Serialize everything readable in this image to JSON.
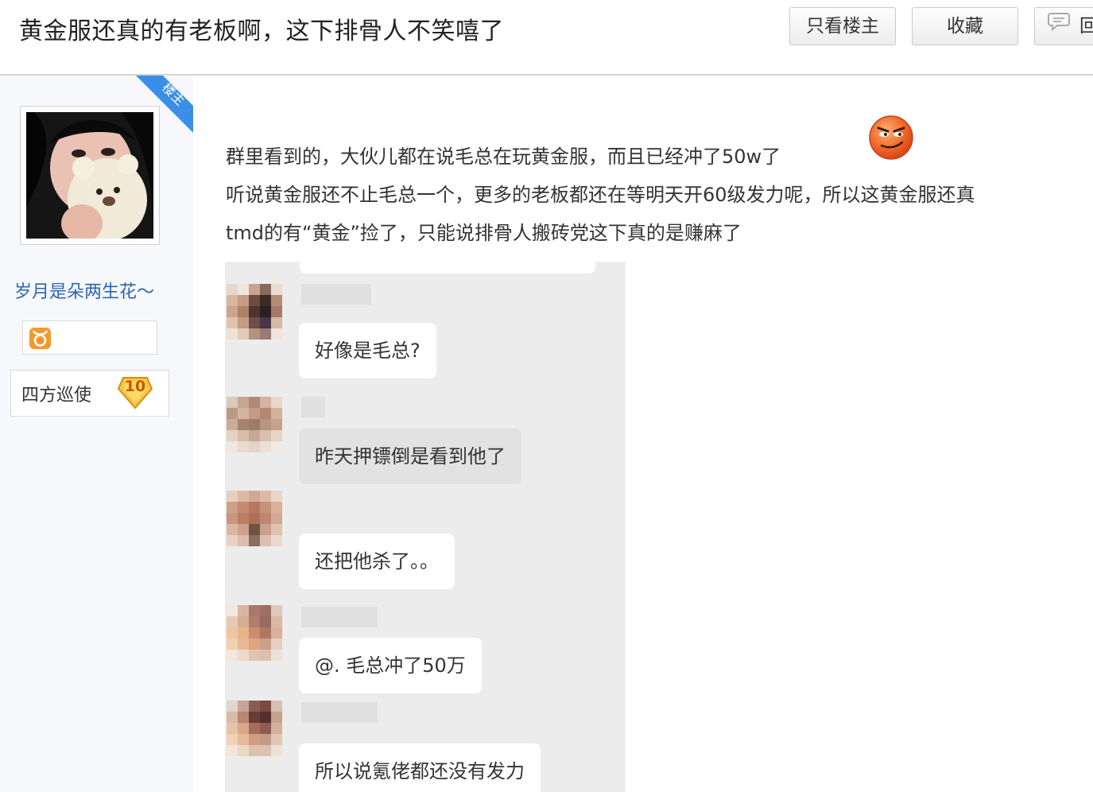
{
  "header": {
    "title": "黄金服还真的有老板啊，这下排骨人不笑嘻了",
    "btn_only_op": "只看楼主",
    "btn_favorite": "收藏",
    "btn_reply": "回复"
  },
  "author": {
    "badge": "楼主",
    "username": "岁月是朵两生花～",
    "level_title": "四方巡使",
    "level": "10",
    "icons": [
      "taurus-icon"
    ]
  },
  "post": {
    "lines": [
      "群里看到的，大伙儿都在说毛总在玩黄金服，而且已经冲了50w了",
      "听说黄金服还不止毛总一个，更多的老板都还在等明天开60级发力呢，所以这黄金服还真",
      "tmd的有“黄金”捡了，只能说排骨人搬砖党这下真的是赚麻了"
    ]
  },
  "chat": {
    "messages": [
      {
        "text": "好像是毛总?",
        "style": "white"
      },
      {
        "text": "昨天押镖倒是看到他了",
        "style": "grey"
      },
      {
        "text": "还把他杀了。。",
        "style": "white"
      },
      {
        "text": "@. 毛总冲了50万",
        "style": "white"
      },
      {
        "text": "所以说氪佬都还没有发力",
        "style": "white"
      }
    ]
  },
  "colors": {
    "accent_blue": "#3a8ee6",
    "username_blue": "#2d64b3",
    "header_border": "#d4d4d4",
    "sidebar_bg": "#f6f8fc"
  }
}
